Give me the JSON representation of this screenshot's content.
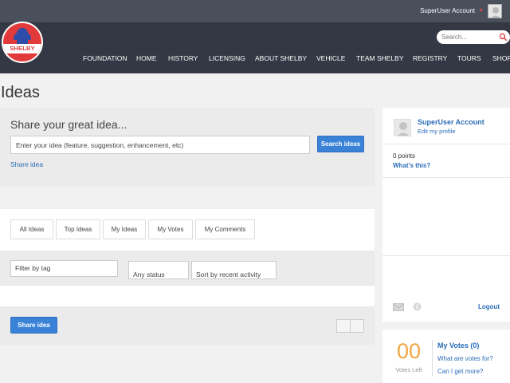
{
  "header": {
    "account_name": "SuperUser Account",
    "logo_text": "SHELBY",
    "search_placeholder": "Search...",
    "nav": [
      "FOUNDATION",
      "HOME",
      "HISTORY",
      "LICENSING",
      "ABOUT SHELBY",
      "VEHICLE",
      "TEAM SHELBY",
      "REGISTRY",
      "TOURS",
      "SHOP"
    ]
  },
  "page": {
    "title": "Ideas",
    "share_heading": "Share your great idea...",
    "idea_input_value": "Enter your idea (feature, suggestion, enhancement, etc)",
    "search_ideas_button": "Search ideas",
    "share_idea_link": "Share idea",
    "tabs": [
      "All Ideas",
      "Top Ideas",
      "My Ideas",
      "My Votes",
      "My Comments"
    ],
    "filter_tag": "Filter by tag",
    "filter_status": "Any status",
    "filter_sort": "Sort by recent activity",
    "share_idea_button": "Share idea"
  },
  "sidebar": {
    "user_name": "SuperUser Account",
    "edit_profile": "Edit my profile",
    "points": "0 points",
    "whats_this": "What's this?",
    "logout": "Logout",
    "votes_left_count": "00",
    "votes_left_label": "Votes Left",
    "my_votes": "My Votes (0)",
    "what_are_votes": "What are votes for?",
    "can_i_get_more": "Can I get more?"
  },
  "colors": {
    "topbar": "#4a4f5c",
    "navbar": "#333844",
    "accent_blue": "#3a82d8",
    "link_blue": "#2a6db8",
    "votes_orange": "#f0a742",
    "logo_red": "#e23a3a"
  }
}
